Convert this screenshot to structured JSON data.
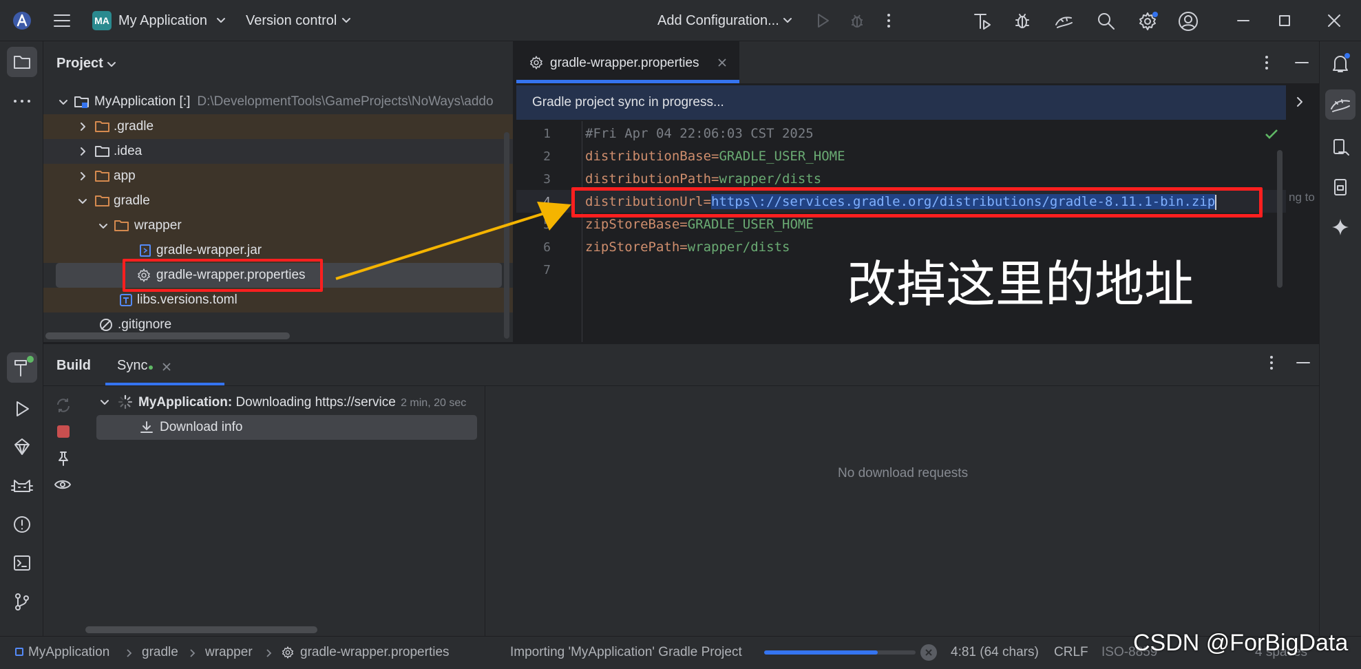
{
  "titlebar": {
    "logo_initials": "MA",
    "project_name": "My Application",
    "vcs_label": "Version control",
    "run_config_label": "Add Configuration..."
  },
  "project_panel": {
    "title": "Project",
    "tree": [
      {
        "label": "MyApplication [:]",
        "path": "D:\\DevelopmentTools\\GameProjects\\NoWays\\addo",
        "kind": "module"
      },
      {
        "label": ".gradle",
        "kind": "folder"
      },
      {
        "label": ".idea",
        "kind": "folder"
      },
      {
        "label": "app",
        "kind": "folder"
      },
      {
        "label": "gradle",
        "kind": "folder"
      },
      {
        "label": "wrapper",
        "kind": "folder"
      },
      {
        "label": "gradle-wrapper.jar",
        "kind": "jar"
      },
      {
        "label": "gradle-wrapper.properties",
        "kind": "properties"
      },
      {
        "label": "libs.versions.toml",
        "kind": "toml"
      },
      {
        "label": ".gitignore",
        "kind": "ignore"
      }
    ]
  },
  "editor": {
    "tab_label": "gradle-wrapper.properties",
    "banner": "Gradle project sync in progress...",
    "hint_cut": "ng to",
    "lines": [
      {
        "n": "1",
        "key": "#Fri Apr 04 22:06:03 CST 2025",
        "eq": "",
        "val": "",
        "comment": true
      },
      {
        "n": "2",
        "key": "distributionBase",
        "eq": "=",
        "val": "GRADLE_USER_HOME"
      },
      {
        "n": "3",
        "key": "distributionPath",
        "eq": "=",
        "val": "wrapper/dists"
      },
      {
        "n": "4",
        "key": "distributionUrl",
        "eq": "=",
        "val": "https\\://services.gradle.org/distributions/gradle-8.11.1-bin.zip"
      },
      {
        "n": "5",
        "key": "zipStoreBase",
        "eq": "=",
        "val": "GRADLE_USER_HOME"
      },
      {
        "n": "6",
        "key": "zipStorePath",
        "eq": "=",
        "val": "wrapper/dists"
      },
      {
        "n": "7",
        "key": "",
        "eq": "",
        "val": ""
      }
    ],
    "annotation": "改掉这里的地址"
  },
  "build": {
    "tab_build": "Build",
    "tab_sync": "Sync",
    "task_title": "MyApplication:",
    "task_status": "Downloading https://service",
    "task_time": "2 min, 20 sec",
    "child_label": "Download info",
    "empty_text": "No download requests"
  },
  "statusbar": {
    "crumbs": [
      "MyApplication",
      "gradle",
      "wrapper",
      "gradle-wrapper.properties"
    ],
    "progress_label": "Importing 'MyApplication' Gradle Project",
    "progress": 0.75,
    "position": "4:81 (64 chars)",
    "line_sep": "CRLF",
    "encoding": "ISO-8859",
    "indent": "4 spaces"
  },
  "watermark": "CSDN @ForBigData",
  "colors": {
    "accent": "#3574f0",
    "highlight_red": "#ff1f1f",
    "arrow": "#f5b400",
    "sel_bg": "#214283"
  }
}
